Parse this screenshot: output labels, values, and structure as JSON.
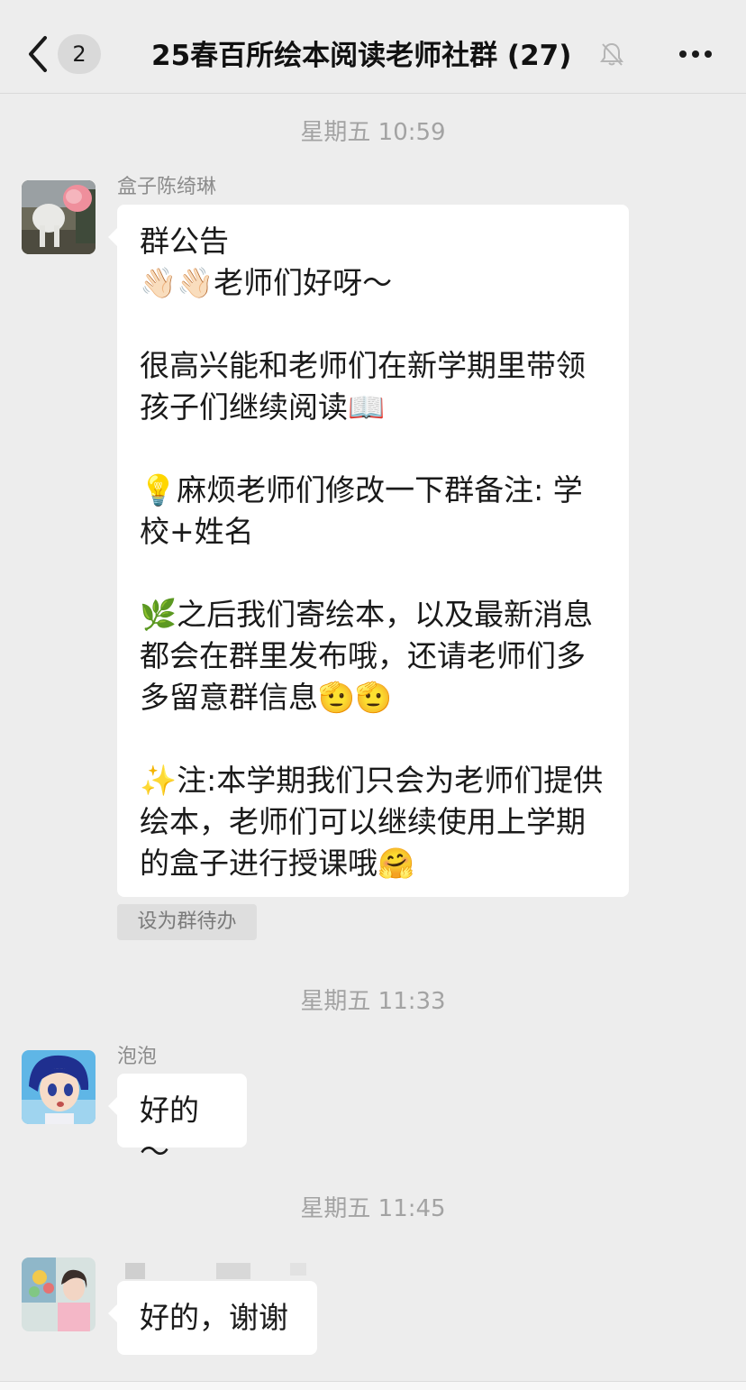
{
  "nav": {
    "back_badge": "2",
    "title": "25春百所绘本阅读老师社群 (27)"
  },
  "times": [
    "星期五 10:59",
    "星期五 11:33",
    "星期五 11:45"
  ],
  "messages": [
    {
      "sender": "盒子陈绮琳",
      "text": "群公告\n👋🏻👋🏻老师们好呀～\n\n很高兴能和老师们在新学期里带领孩子们继续阅读📖\n\n💡麻烦老师们修改一下群备注: 学校+姓名\n\n🌿之后我们寄绘本，以及最新消息都会在群里发布哦，还请老师们多多留意群信息🫡🫡\n\n✨注:本学期我们只会为老师们提供绘本，老师们可以继续使用上学期的盒子进行授课哦🤗",
      "action": "设为群待办"
    },
    {
      "sender": "泡泡",
      "text": "好的～"
    },
    {
      "sender": "",
      "text": "好的，谢谢"
    }
  ],
  "icons": {
    "back": "chevron-left-icon",
    "mute": "bell-off-icon",
    "more": "more-dots-icon"
  }
}
